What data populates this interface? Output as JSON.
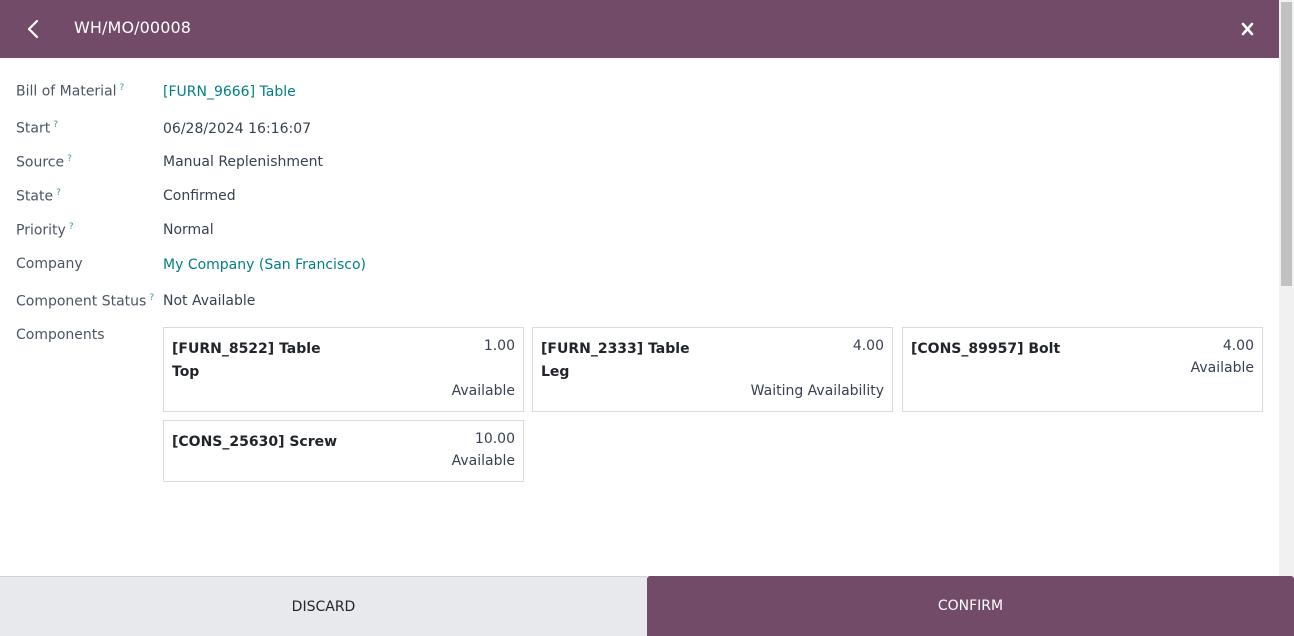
{
  "header": {
    "title": "WH/MO/00008",
    "back_icon": "chevron-left-icon",
    "close_icon": "close-icon",
    "background": "#714b67"
  },
  "form": {
    "bill_of_material": {
      "label": "Bill of Material",
      "help": "?",
      "value": "[FURN_9666] Table"
    },
    "start": {
      "label": "Start",
      "help": "?",
      "value": "06/28/2024 16:16:07"
    },
    "source": {
      "label": "Source",
      "help": "?",
      "value": "Manual Replenishment"
    },
    "state": {
      "label": "State",
      "help": "?",
      "value": "Confirmed"
    },
    "priority": {
      "label": "Priority",
      "help": "?",
      "value": "Normal"
    },
    "company": {
      "label": "Company",
      "value": "My Company (San Francisco)"
    },
    "component_status": {
      "label": "Component Status",
      "help": "?",
      "value": "Not Available"
    },
    "components_label": "Components"
  },
  "components": [
    {
      "name": "[FURN_8522] Table Top",
      "qty": "1.00",
      "status": "Available"
    },
    {
      "name": "[FURN_2333] Table Leg",
      "qty": "4.00",
      "status": "Waiting Availability"
    },
    {
      "name": "[CONS_89957] Bolt",
      "qty": "4.00",
      "status": "Available"
    },
    {
      "name": "[CONS_25630] Screw",
      "qty": "10.00",
      "status": "Available"
    }
  ],
  "footer": {
    "discard_label": "DISCARD",
    "confirm_label": "CONFIRM"
  },
  "colors": {
    "primary": "#714b67",
    "link": "#017e84"
  }
}
